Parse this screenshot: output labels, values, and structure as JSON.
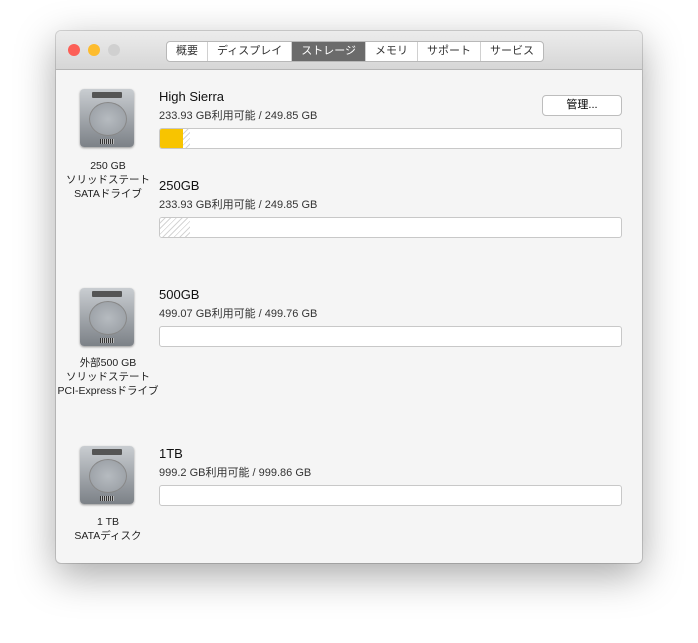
{
  "tabs": [
    "概要",
    "ディスプレイ",
    "ストレージ",
    "メモリ",
    "サポート",
    "サービス"
  ],
  "active_tab": "ストレージ",
  "manage_button": "管理...",
  "disks": [
    {
      "label": [
        "250 GB",
        "ソリッドステート",
        "SATAドライブ"
      ],
      "volumes": [
        {
          "name": "High Sierra",
          "info": "233.93 GB利用可能 / 249.85 GB",
          "used_fraction": 0.05,
          "other_fraction": 0.015
        },
        {
          "name": "250GB",
          "info": "233.93 GB利用可能 / 249.85 GB",
          "used_fraction": 0,
          "other_fraction": 0.065
        }
      ]
    },
    {
      "label": [
        "外部500 GB",
        "ソリッドステート",
        "PCI-Expressドライブ"
      ],
      "volumes": [
        {
          "name": "500GB",
          "info": "499.07 GB利用可能 / 499.76 GB",
          "used_fraction": 0,
          "other_fraction": 0
        }
      ]
    },
    {
      "label": [
        "1 TB",
        "SATAディスク"
      ],
      "volumes": [
        {
          "name": "1TB",
          "info": "999.2 GB利用可能 / 999.86 GB",
          "used_fraction": 0,
          "other_fraction": 0
        }
      ]
    }
  ],
  "colors": {
    "used": "#f8c400",
    "close": "#fc5f57",
    "minimize": "#fdbc2e",
    "zoom": "#d0d0d0"
  }
}
